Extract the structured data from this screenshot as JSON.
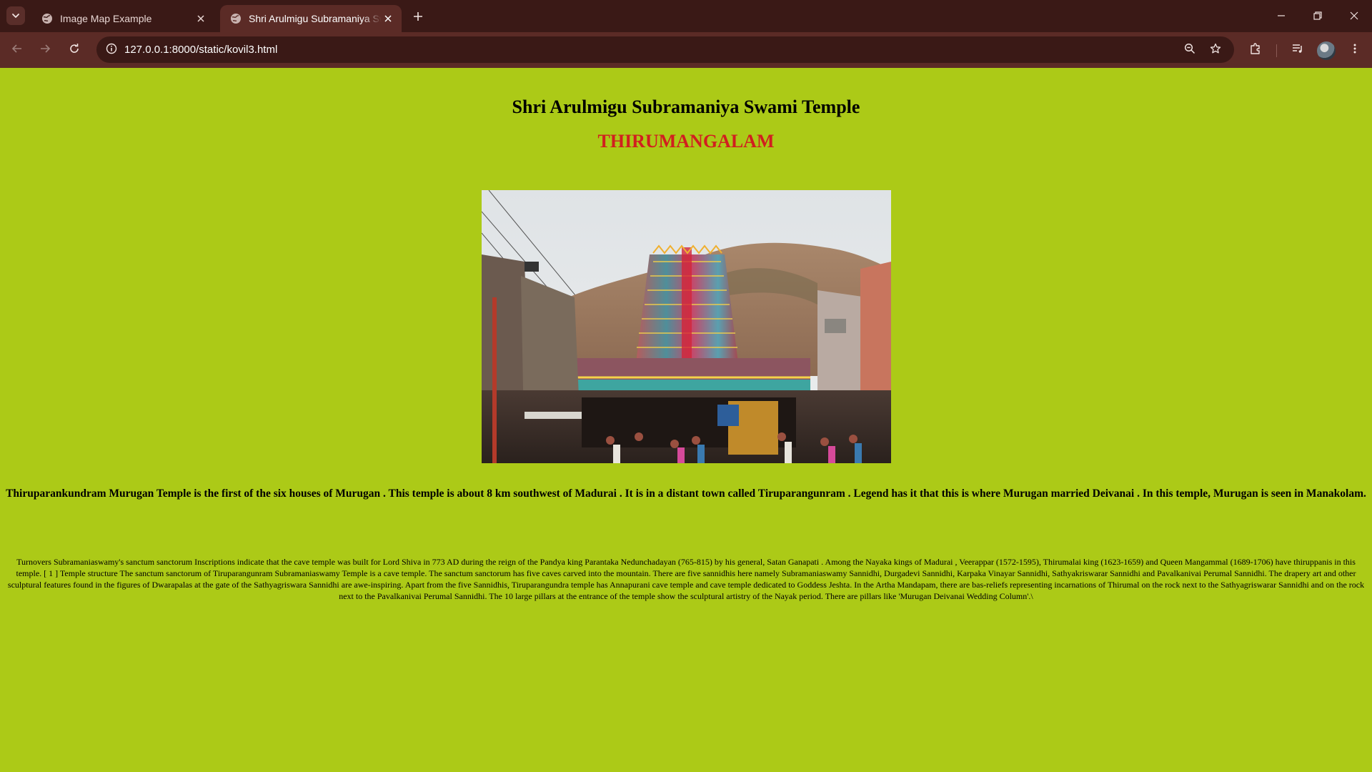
{
  "browser": {
    "tabs": [
      {
        "title": "Image Map Example",
        "active": false
      },
      {
        "title": "Shri Arulmigu Subramaniya Swami Temple",
        "active": true
      }
    ],
    "url": "127.0.0.1:8000/static/kovil3.html",
    "icons": {
      "tab_search": "chevron-down-icon",
      "favicon": "globe-icon",
      "close": "close-icon",
      "new_tab": "plus-icon",
      "minimize": "minimize-icon",
      "restore": "restore-icon",
      "window_close": "close-icon",
      "back": "arrow-left-icon",
      "forward": "arrow-right-icon",
      "reload": "reload-icon",
      "site_info": "info-icon",
      "zoom": "zoom-icon",
      "bookmark": "star-icon",
      "extensions": "puzzle-icon",
      "media": "media-control-icon",
      "profile": "avatar",
      "menu": "kebab-menu-icon"
    },
    "colors": {
      "tabstrip": "#3a1916",
      "toolbar": "#5b2b26",
      "omnibox": "#3a1916"
    }
  },
  "page": {
    "title": "Shri Arulmigu Subramaniya Swami Temple",
    "subtitle": "THIRUMANGALAM",
    "intro": "Thiruparankundram Murugan Temple is the first of the six houses of Murugan . This temple is about 8 km southwest of Madurai . It is in a distant town called Tiruparangunram . Legend has it that this is where Murugan married Deivanai . In this temple, Murugan is seen in Manakolam.",
    "detail": "Turnovers Subramaniaswamy's sanctum sanctorum Inscriptions indicate that the cave temple was built for Lord Shiva in 773 AD during the reign of the Pandya king Parantaka Nedunchadayan (765-815) by his general, Satan Ganapati . Among the Nayaka kings of Madurai , Veerappar (1572-1595), Thirumalai king (1623-1659) and Queen Mangammal (1689-1706) have thiruppanis in this temple. [ 1 ] Temple structure The sanctum sanctorum of Tiruparangunram Subramaniaswamy Temple is a cave temple. The sanctum sanctorum has five caves carved into the mountain. There are five sannidhis here namely Subramaniaswamy Sannidhi, Durgadevi Sannidhi, Karpaka Vinayar Sannidhi, Sathyakriswarar Sannidhi and Pavalkanivai Perumal Sannidhi. The drapery art and other sculptural features found in the figures of Dwarapalas at the gate of the Sathyagriswara Sannidhi are awe-inspiring. Apart from the five Sannidhis, Tiruparangundra temple has Annapurani cave temple and cave temple dedicated to Goddess Jeshta. In the Artha Mandapam, there are bas-reliefs representing incarnations of Thirumal on the rock next to the Sathyagriswarar Sannidhi and on the rock next to the Pavalkanivai Perumal Sannidhi. The 10 large pillars at the entrance of the temple show the sculptural artistry of the Nayak period. There are pillars like 'Murugan Deivanai Wedding Column'.\\",
    "colors": {
      "background": "#acca17",
      "title": "#000000",
      "subtitle": "#d11f1f"
    }
  }
}
